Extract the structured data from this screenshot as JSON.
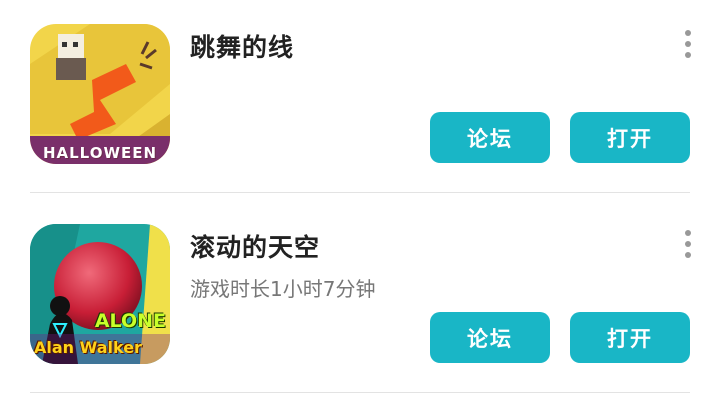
{
  "games": [
    {
      "title": "跳舞的线",
      "subtitle": "",
      "icon": "dancing-line-halloween-icon",
      "icon_text": "HALLOWEEN",
      "forum_label": "论坛",
      "open_label": "打开"
    },
    {
      "title": "滚动的天空",
      "subtitle": "游戏时长1小时7分钟",
      "icon": "rolling-sky-alan-walker-icon",
      "icon_text_1": "ALONE",
      "icon_text_2": "Alan Walker",
      "forum_label": "论坛",
      "open_label": "打开"
    }
  ],
  "colors": {
    "button": "#19b6c6",
    "title": "#222222",
    "subtitle": "#777777",
    "divider": "#e3e3e3"
  }
}
